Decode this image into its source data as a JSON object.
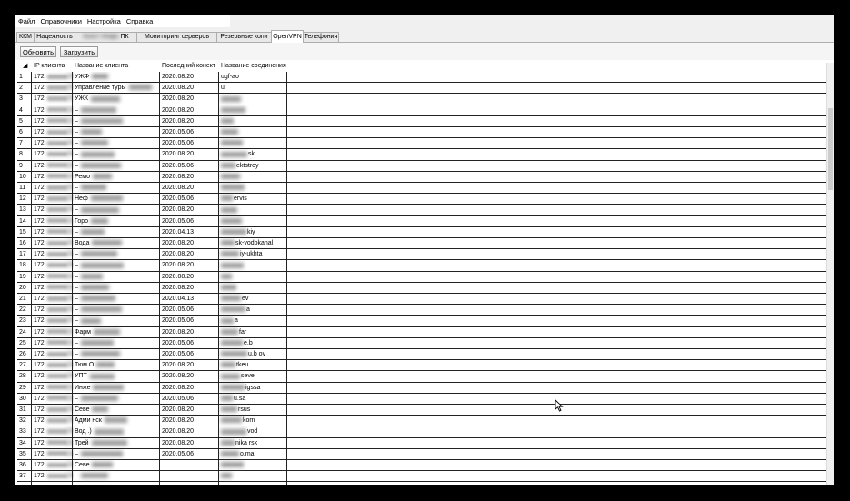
{
  "menu": [
    "Файл",
    "Справочники",
    "Настройка",
    "Справка"
  ],
  "tabs": [
    {
      "label": "ККМ"
    },
    {
      "label": "Надежность"
    },
    {
      "label": "ПК"
    },
    {
      "label": "Мониторинг серверов"
    },
    {
      "label": "Резервные копи"
    },
    {
      "label": "OpenVPN"
    },
    {
      "label": "Телефония"
    }
  ],
  "active_tab": "OpenVPN",
  "toolbar": {
    "refresh_label": "Обновить",
    "load_label": "Загрузить"
  },
  "columns": [
    "IP клиента",
    "Название клиента",
    "Последний конект",
    "Название соединения"
  ],
  "rows": [
    {
      "n": "1",
      "ip": "172.",
      "ip_tail": "26.",
      "name": "УЖФ",
      "date": "2020.08.20",
      "conn": "ugf-ao"
    },
    {
      "n": "2",
      "ip": "172.",
      "ip_tail": "26.",
      "name": "Управление  туры",
      "date": "2020.08.20",
      "conn": "u"
    },
    {
      "n": "3",
      "ip": "172.",
      "ip_tail": "26.",
      "name": "УЖК",
      "date": "2020.08.20",
      "conn": ""
    },
    {
      "n": "4",
      "ip": "172.",
      "ip_tail": "26.",
      "name": "–",
      "date": "2020.08.20",
      "conn": ""
    },
    {
      "n": "5",
      "ip": "172.",
      "ip_tail": "26.",
      "name": "–",
      "date": "2020.08.20",
      "conn": ""
    },
    {
      "n": "6",
      "ip": "172.",
      "ip_tail": "26.",
      "name": "–",
      "date": "2020.05.06",
      "conn": ""
    },
    {
      "n": "7",
      "ip": "172.",
      "ip_tail": "26.",
      "name": "–",
      "date": "2020.05.06",
      "conn": ""
    },
    {
      "n": "8",
      "ip": "172.",
      "ip_tail": "26.",
      "name": "–",
      "date": "2020.08.20",
      "conn": "sk"
    },
    {
      "n": "9",
      "ip": "172.",
      "ip_tail": "26.",
      "name": "–",
      "date": "2020.05.06",
      "conn": "ektstroy"
    },
    {
      "n": "10",
      "ip": "172.",
      "ip_tail": "26.",
      "name": "Ремо",
      "date": "2020.08.20",
      "conn": ""
    },
    {
      "n": "11",
      "ip": "172.",
      "ip_tail": "26.",
      "name": "–",
      "date": "2020.08.20",
      "conn": ""
    },
    {
      "n": "12",
      "ip": "172.",
      "ip_tail": "26.",
      "name": "Неф",
      "date": "2020.05.06",
      "conn": "ervis"
    },
    {
      "n": "13",
      "ip": "172.",
      "ip_tail": "26.",
      "name": "–",
      "date": "2020.08.20",
      "conn": ""
    },
    {
      "n": "14",
      "ip": "172.",
      "ip_tail": "26.",
      "name": "Горо",
      "date": "2020.05.06",
      "conn": ""
    },
    {
      "n": "15",
      "ip": "172.",
      "ip_tail": "26.",
      "name": "–",
      "date": "2020.04.13",
      "conn": "kiy"
    },
    {
      "n": "16",
      "ip": "172.",
      "ip_tail": "26.",
      "name": "Вода",
      "date": "2020.08.20",
      "conn": "sk-vodokanal"
    },
    {
      "n": "17",
      "ip": "172.",
      "ip_tail": "26.",
      "name": "–",
      "date": "2020.08.20",
      "conn": "iy-ukhta"
    },
    {
      "n": "18",
      "ip": "172.",
      "ip_tail": "26.",
      "name": "–",
      "date": "2020.08.20",
      "conn": ""
    },
    {
      "n": "19",
      "ip": "172.",
      "ip_tail": "26.",
      "name": "–",
      "date": "2020.08.20",
      "conn": ""
    },
    {
      "n": "20",
      "ip": "172.",
      "ip_tail": "26.",
      "name": "–",
      "date": "2020.08.20",
      "conn": ""
    },
    {
      "n": "21",
      "ip": "172.",
      "ip_tail": "26.",
      "name": "–",
      "date": "2020.04.13",
      "conn": "ev"
    },
    {
      "n": "22",
      "ip": "172.",
      "ip_tail": "26.",
      "name": "–",
      "date": "2020.05.06",
      "conn": "a"
    },
    {
      "n": "23",
      "ip": "172.",
      "ip_tail": "26.",
      "name": "–",
      "date": "2020.05.06",
      "conn": "a"
    },
    {
      "n": "24",
      "ip": "172.",
      "ip_tail": "26.",
      "name": "Фарм",
      "date": "2020.08.20",
      "conn": "far"
    },
    {
      "n": "25",
      "ip": "172.",
      "ip_tail": "26.",
      "name": "–",
      "date": "2020.05.06",
      "conn": "e.b"
    },
    {
      "n": "26",
      "ip": "172.",
      "ip_tail": "26.",
      "name": "–",
      "date": "2020.05.06",
      "conn": "u.b ov"
    },
    {
      "n": "27",
      "ip": "172.",
      "ip_tail": "26.",
      "name": "Тюм  О",
      "date": "2020.08.20",
      "conn": "tkeu"
    },
    {
      "n": "28",
      "ip": "172.",
      "ip_tail": "26.",
      "name": "УПТ",
      "date": "2020.08.20",
      "conn": "seve"
    },
    {
      "n": "29",
      "ip": "172.",
      "ip_tail": "26.",
      "name": "Инже",
      "date": "2020.08.20",
      "conn": "igssa"
    },
    {
      "n": "30",
      "ip": "172.",
      "ip_tail": "26.",
      "name": "–",
      "date": "2020.05.06",
      "conn": "u.sa"
    },
    {
      "n": "31",
      "ip": "172.",
      "ip_tail": "26.",
      "name": "Севе",
      "date": "2020.08.20",
      "conn": "rsus"
    },
    {
      "n": "32",
      "ip": "172.",
      "ip_tail": "26.",
      "name": "Адми  нск",
      "date": "2020.08.20",
      "conn": "kom"
    },
    {
      "n": "33",
      "ip": "172.",
      "ip_tail": "26.",
      "name": "Вод  .)",
      "date": "2020.08.20",
      "conn": "vod"
    },
    {
      "n": "34",
      "ip": "172.",
      "ip_tail": "26.",
      "name": "Трей",
      "date": "2020.08.20",
      "conn": "nika  rsk"
    },
    {
      "n": "35",
      "ip": "172.",
      "ip_tail": "26.",
      "name": "–",
      "date": "2020.05.06",
      "conn": "o.ma"
    },
    {
      "n": "36",
      "ip": "172.",
      "ip_tail": "26.",
      "name": "Севе",
      "date": "",
      "conn": ""
    },
    {
      "n": "37",
      "ip": "172.",
      "ip_tail": "26.",
      "name": "–",
      "date": "",
      "conn": ""
    }
  ]
}
